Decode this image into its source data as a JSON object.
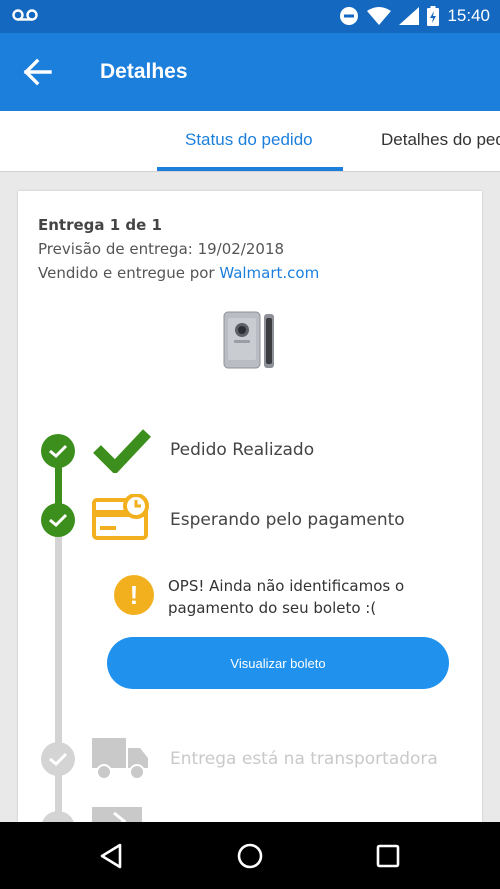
{
  "status_bar": {
    "time": "15:40"
  },
  "app_bar": {
    "title": "Detalhes"
  },
  "tabs": [
    {
      "label": "Status do pedido",
      "active": true
    },
    {
      "label": "Detalhes do pedido",
      "active": false
    }
  ],
  "order": {
    "delivery_count": "Entrega 1 de 1",
    "forecast": "Previsão de entrega: 19/02/2018",
    "sold_by_prefix": "Vendido e entregue por ",
    "seller": "Walmart.com"
  },
  "steps": [
    {
      "label": "Pedido Realizado",
      "state": "done",
      "icon": "checkmark-icon"
    },
    {
      "label": "Esperando pelo pagamento",
      "state": "current",
      "icon": "payment-card-clock-icon"
    },
    {
      "label": "Entrega está na transportadora",
      "state": "pending",
      "icon": "truck-icon"
    }
  ],
  "payment_alert": {
    "icon": "!",
    "message": "OPS! Ainda não identificamos o pagamento do seu boleto :("
  },
  "boleto_button": {
    "label": "Visualizar boleto"
  },
  "colors": {
    "primary": "#1d7fdc",
    "success": "#3c8f1c",
    "warning": "#f2b01e",
    "button": "#2092ee",
    "pending": "#d4d4d4"
  }
}
